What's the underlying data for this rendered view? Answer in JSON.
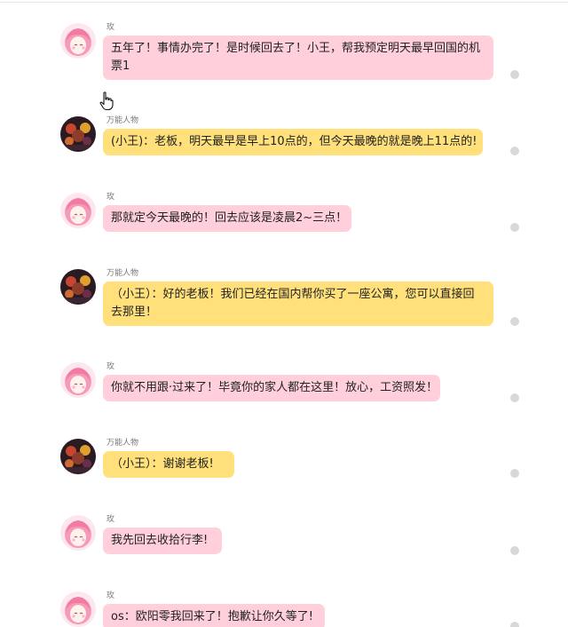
{
  "colors": {
    "pink_bubble": "#ffd0dc",
    "yellow_bubble": "#ffe07a",
    "dot": "#d8d8d8"
  },
  "messages": [
    {
      "sender": "玫",
      "avatar": "pink-hair-girl-avatar",
      "text": "五年了！事情办完了！是时候回去了！小王，帮我预定明天最早回国的机票1"
    },
    {
      "sender": "万能人物",
      "avatar": "character-group-avatar",
      "text": "(小王)：老板，明天最早是早上10点的，但今天最晚的就是晚上11点的!"
    },
    {
      "sender": "玫",
      "avatar": "pink-hair-girl-avatar",
      "text": "那就定今天最晚的！回去应该是凌晨2~三点！"
    },
    {
      "sender": "万能人物",
      "avatar": "character-group-avatar",
      "text": "（小王）：好的老板！我们已经在国内帮你买了一座公寓，您可以直接回去那里！"
    },
    {
      "sender": "玫",
      "avatar": "pink-hair-girl-avatar",
      "text": "你就不用跟·过来了！毕竟你的家人都在这里！放心，工资照发！"
    },
    {
      "sender": "万能人物",
      "avatar": "character-group-avatar",
      "text": "（小王）：谢谢老板!"
    },
    {
      "sender": "玫",
      "avatar": "pink-hair-girl-avatar",
      "text": "我先回去收拾行李!"
    },
    {
      "sender": "玫",
      "avatar": "pink-hair-girl-avatar",
      "text": "os：欧阳零我回来了！抱歉让你久等了!"
    }
  ]
}
